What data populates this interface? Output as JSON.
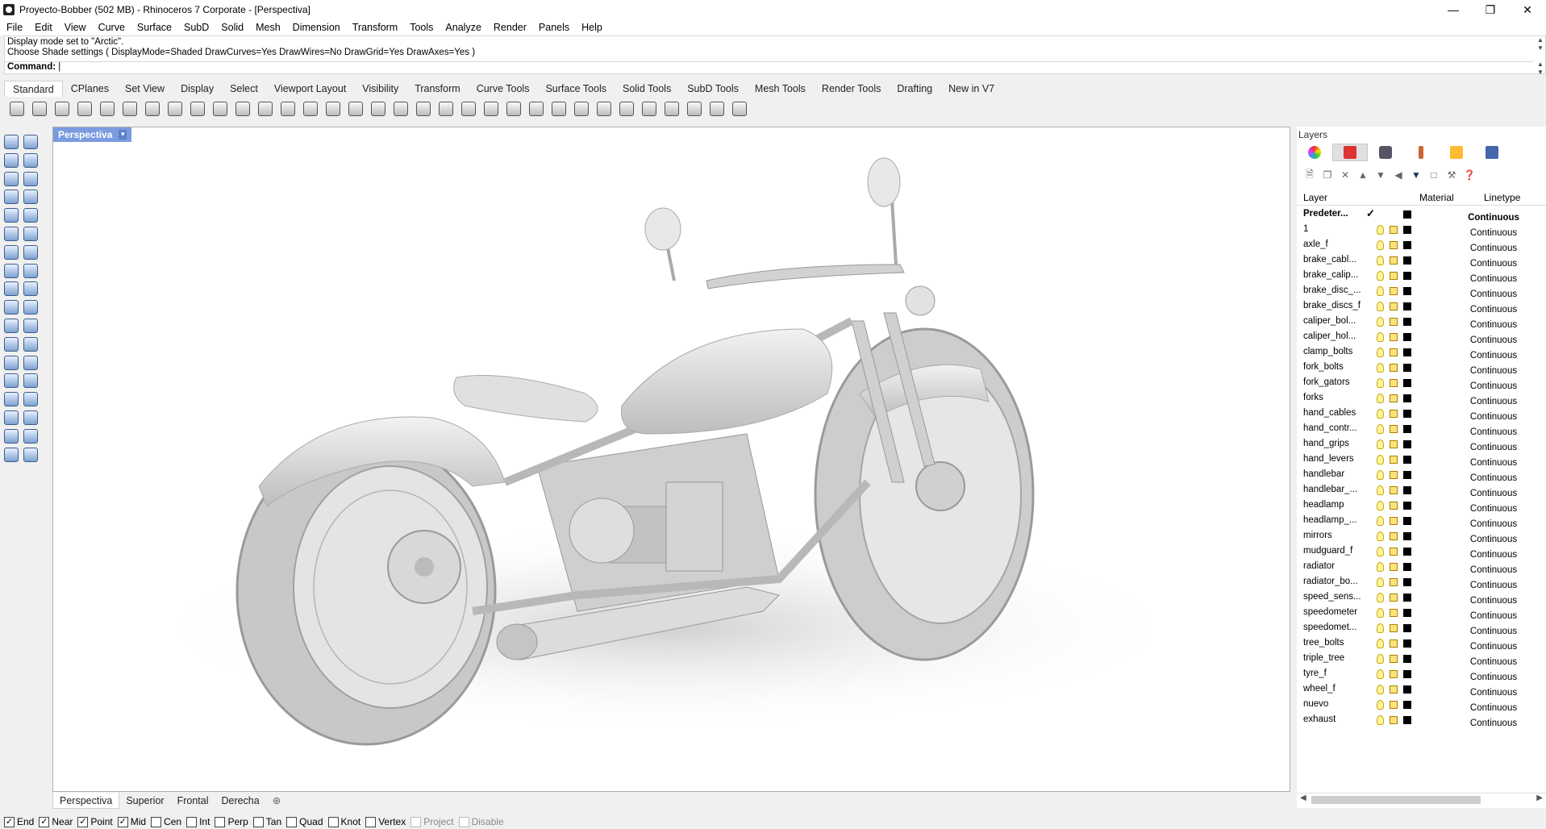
{
  "window": {
    "title": "Proyecto-Bobber (502 MB) - Rhinoceros 7 Corporate - [Perspectiva]"
  },
  "menu": [
    "File",
    "Edit",
    "View",
    "Curve",
    "Surface",
    "SubD",
    "Solid",
    "Mesh",
    "Dimension",
    "Transform",
    "Tools",
    "Analyze",
    "Render",
    "Panels",
    "Help"
  ],
  "command": {
    "history": [
      "Display mode set to \"Arctic\".",
      "Choose Shade settings ( DisplayMode=Shaded  DrawCurves=Yes  DrawWires=No  DrawGrid=Yes  DrawAxes=Yes )"
    ],
    "prompt": "Command:"
  },
  "toolbar_tabs": [
    "Standard",
    "CPlanes",
    "Set View",
    "Display",
    "Select",
    "Viewport Layout",
    "Visibility",
    "Transform",
    "Curve Tools",
    "Surface Tools",
    "Solid Tools",
    "SubD Tools",
    "Mesh Tools",
    "Render Tools",
    "Drafting",
    "New in V7"
  ],
  "viewport": {
    "title": "Perspectiva"
  },
  "viewport_tabs": [
    "Perspectiva",
    "Superior",
    "Frontal",
    "Derecha"
  ],
  "osnaps": [
    {
      "label": "End",
      "checked": true
    },
    {
      "label": "Near",
      "checked": true
    },
    {
      "label": "Point",
      "checked": true
    },
    {
      "label": "Mid",
      "checked": true
    },
    {
      "label": "Cen",
      "checked": false
    },
    {
      "label": "Int",
      "checked": false
    },
    {
      "label": "Perp",
      "checked": false
    },
    {
      "label": "Tan",
      "checked": false
    },
    {
      "label": "Quad",
      "checked": false
    },
    {
      "label": "Knot",
      "checked": false
    },
    {
      "label": "Vertex",
      "checked": false
    },
    {
      "label": "Project",
      "checked": false,
      "disabled": true
    },
    {
      "label": "Disable",
      "checked": false,
      "disabled": true
    }
  ],
  "layers_panel": {
    "title": "Layers",
    "columns": {
      "layer": "Layer",
      "material": "Material",
      "linetype": "Linetype"
    },
    "rows": [
      {
        "name": "Predeter...",
        "linetype": "Continuous",
        "current": true
      },
      {
        "name": "1",
        "linetype": "Continuous"
      },
      {
        "name": "axle_f",
        "linetype": "Continuous"
      },
      {
        "name": "brake_cabl...",
        "linetype": "Continuous"
      },
      {
        "name": "brake_calip...",
        "linetype": "Continuous"
      },
      {
        "name": "brake_disc_...",
        "linetype": "Continuous"
      },
      {
        "name": "brake_discs_f",
        "linetype": "Continuous"
      },
      {
        "name": "caliper_bol...",
        "linetype": "Continuous"
      },
      {
        "name": "caliper_hol...",
        "linetype": "Continuous"
      },
      {
        "name": "clamp_bolts",
        "linetype": "Continuous"
      },
      {
        "name": "fork_bolts",
        "linetype": "Continuous"
      },
      {
        "name": "fork_gators",
        "linetype": "Continuous"
      },
      {
        "name": "forks",
        "linetype": "Continuous"
      },
      {
        "name": "hand_cables",
        "linetype": "Continuous"
      },
      {
        "name": "hand_contr...",
        "linetype": "Continuous"
      },
      {
        "name": "hand_grips",
        "linetype": "Continuous"
      },
      {
        "name": "hand_levers",
        "linetype": "Continuous"
      },
      {
        "name": "handlebar",
        "linetype": "Continuous"
      },
      {
        "name": "handlebar_...",
        "linetype": "Continuous"
      },
      {
        "name": "headlamp",
        "linetype": "Continuous"
      },
      {
        "name": "headlamp_...",
        "linetype": "Continuous"
      },
      {
        "name": "mirrors",
        "linetype": "Continuous"
      },
      {
        "name": "mudguard_f",
        "linetype": "Continuous"
      },
      {
        "name": "radiator",
        "linetype": "Continuous"
      },
      {
        "name": "radiator_bo...",
        "linetype": "Continuous"
      },
      {
        "name": "speed_sens...",
        "linetype": "Continuous"
      },
      {
        "name": "speedometer",
        "linetype": "Continuous"
      },
      {
        "name": "speedomet...",
        "linetype": "Continuous"
      },
      {
        "name": "tree_bolts",
        "linetype": "Continuous"
      },
      {
        "name": "triple_tree",
        "linetype": "Continuous"
      },
      {
        "name": "tyre_f",
        "linetype": "Continuous"
      },
      {
        "name": "wheel_f",
        "linetype": "Continuous"
      },
      {
        "name": "nuevo",
        "linetype": "Continuous"
      },
      {
        "name": "exhaust",
        "linetype": "Continuous"
      }
    ]
  },
  "colors": {
    "viewport_title_bg": "#7a9be0",
    "layer_color": "#000000"
  }
}
